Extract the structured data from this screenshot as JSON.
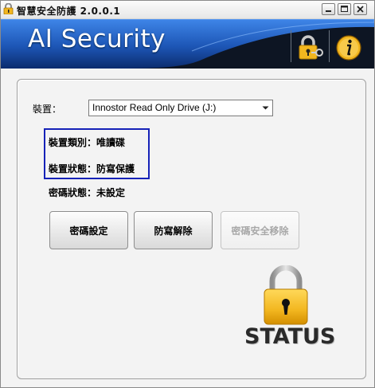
{
  "window": {
    "title": "智慧安全防護 2.0.0.1",
    "controls": {
      "minimize": "minimize-icon",
      "maximize": "maximize-icon",
      "close": "close-icon"
    }
  },
  "banner": {
    "title": "AI Security",
    "icons": [
      "lock-key-icon",
      "info-icon"
    ]
  },
  "device": {
    "label": "裝置：",
    "selected": "Innostor Read Only Drive (J:)"
  },
  "status": {
    "type_line": "裝置類別：唯讀碟",
    "state_line": "裝置狀態：防寫保護",
    "password_line": "密碼狀態：未設定"
  },
  "buttons": {
    "set_password": "密碼設定",
    "release_protect": "防寫解除",
    "remove_password": "密碼安全移除"
  },
  "status_badge": {
    "text": "STATUS",
    "icon": "padlock-icon"
  },
  "colors": {
    "banner_dark": "#0d1523",
    "banner_blue": "#1e56b8",
    "highlight_box": "#1622b8",
    "lock_gold": "#f2b61f"
  }
}
